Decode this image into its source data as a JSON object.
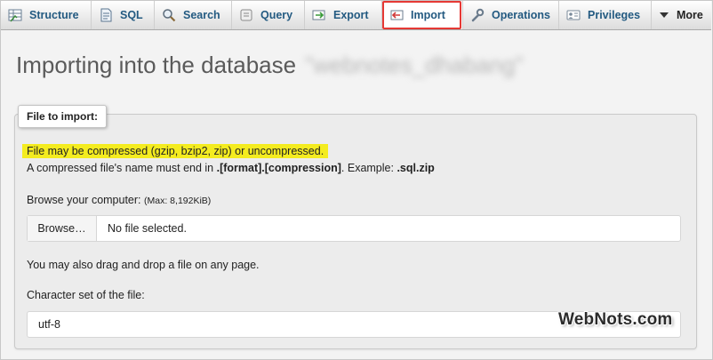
{
  "tabs": [
    {
      "label": "Structure",
      "icon": "structure-icon"
    },
    {
      "label": "SQL",
      "icon": "sql-icon"
    },
    {
      "label": "Search",
      "icon": "search-icon"
    },
    {
      "label": "Query",
      "icon": "query-icon"
    },
    {
      "label": "Export",
      "icon": "export-icon"
    },
    {
      "label": "Import",
      "icon": "import-icon",
      "active": true
    },
    {
      "label": "Operations",
      "icon": "wrench-icon"
    },
    {
      "label": "Privileges",
      "icon": "privileges-icon"
    },
    {
      "label": "More",
      "icon": "caret-down-icon"
    }
  ],
  "heading": {
    "text": "Importing into the database",
    "db_name": "\"webnotes_dhabang\""
  },
  "file_section": {
    "legend": "File to import:",
    "compress_note": "File may be compressed (gzip, bzip2, zip) or uncompressed.",
    "name_note_pre": "A compressed file's name must end in ",
    "name_note_format": ".[format].[compression]",
    "name_note_mid": ". Example: ",
    "name_note_example": ".sql.zip",
    "browse_label": "Browse your computer:",
    "max_size": "(Max: 8,192KiB)",
    "browse_button": "Browse…",
    "no_file": "No file selected.",
    "drag_note": "You may also drag and drop a file on any page.",
    "charset_label": "Character set of the file:",
    "charset_value": "utf-8"
  },
  "watermark": "WebNots.com",
  "colors": {
    "tab_text": "#235a81",
    "highlight": "#f4ec1f",
    "import_outline": "#e53935"
  }
}
